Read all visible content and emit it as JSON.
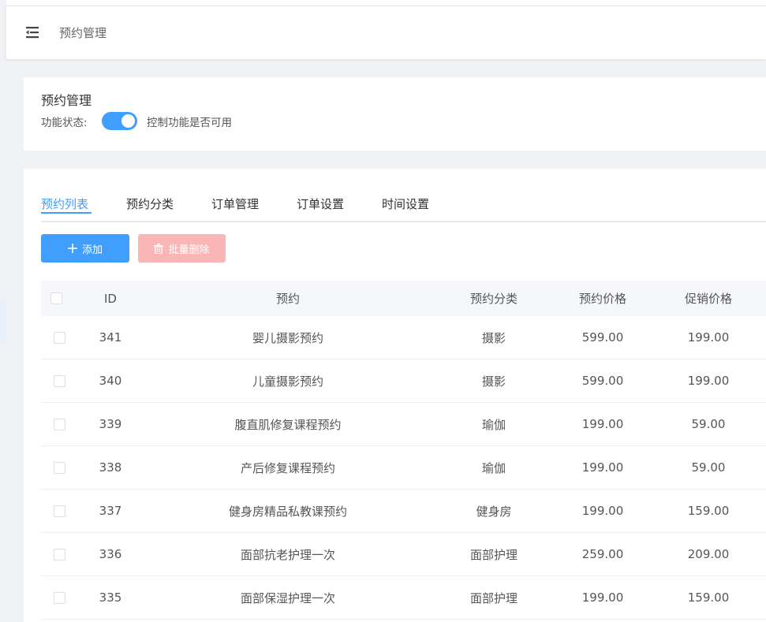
{
  "header": {
    "breadcrumb": "预约管理",
    "menu_icon": "menu-fold-icon"
  },
  "feature": {
    "title": "预约管理",
    "status_label": "功能状态:",
    "toggle_on": true,
    "hint": "控制功能是否可用"
  },
  "tabs": [
    {
      "label": "预约列表",
      "active": true
    },
    {
      "label": "预约分类",
      "active": false
    },
    {
      "label": "订单管理",
      "active": false
    },
    {
      "label": "订单设置",
      "active": false
    },
    {
      "label": "时间设置",
      "active": false
    }
  ],
  "toolbar": {
    "add_label": "添加",
    "delete_label": "批量删除"
  },
  "table": {
    "columns": [
      "ID",
      "预约",
      "预约分类",
      "预约价格",
      "促销价格"
    ],
    "rows": [
      {
        "id": "341",
        "name": "婴儿摄影预约",
        "category": "摄影",
        "price": "599.00",
        "promo": "199.00"
      },
      {
        "id": "340",
        "name": "儿童摄影预约",
        "category": "摄影",
        "price": "599.00",
        "promo": "199.00"
      },
      {
        "id": "339",
        "name": "腹直肌修复课程预约",
        "category": "瑜伽",
        "price": "199.00",
        "promo": "59.00"
      },
      {
        "id": "338",
        "name": "产后修复课程预约",
        "category": "瑜伽",
        "price": "199.00",
        "promo": "59.00"
      },
      {
        "id": "337",
        "name": "健身房精品私教课预约",
        "category": "健身房",
        "price": "199.00",
        "promo": "159.00"
      },
      {
        "id": "336",
        "name": "面部抗老护理一次",
        "category": "面部护理",
        "price": "259.00",
        "promo": "209.00"
      },
      {
        "id": "335",
        "name": "面部保湿护理一次",
        "category": "面部护理",
        "price": "199.00",
        "promo": "159.00"
      }
    ]
  },
  "colors": {
    "primary": "#409eff",
    "danger_disabled": "#fab6b6"
  }
}
